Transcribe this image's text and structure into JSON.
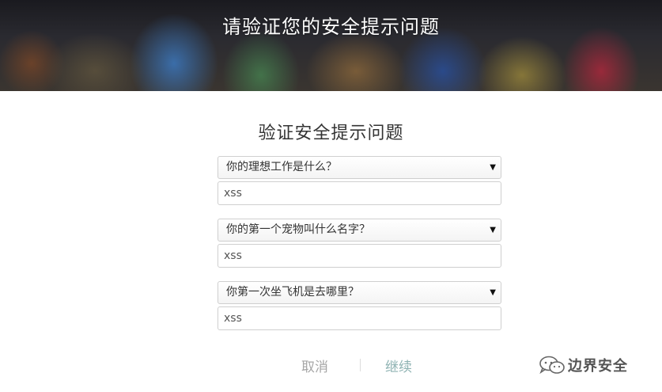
{
  "header": {
    "title": "请验证您的安全提示问题"
  },
  "form": {
    "title": "验证安全提示问题",
    "questions": [
      {
        "question": "你的理想工作是什么？",
        "answer": "xss"
      },
      {
        "question": "你的第一个宠物叫什么名字？",
        "answer": "xss"
      },
      {
        "question": "你第一次坐飞机是去哪里？",
        "answer": "xss"
      }
    ],
    "arrow_glyph": "▼"
  },
  "actions": {
    "cancel_label": "取消",
    "continue_label": "继续"
  },
  "watermark": {
    "text": "边界安全",
    "icon": "wechat-icon"
  },
  "colors": {
    "cancel": "#a6a6a6",
    "continue": "#8fb3b3",
    "banner_text": "#ffffff"
  }
}
